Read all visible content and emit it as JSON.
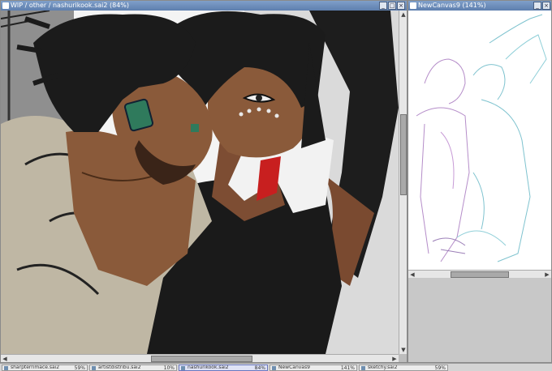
{
  "left_window": {
    "title": "WIP / other / nashurikook.sai2 (84%)",
    "buttons": [
      "_",
      "□",
      "×"
    ]
  },
  "right_window": {
    "title": "NewCanvas9 (141%)",
    "buttons": [
      "_",
      "×"
    ]
  },
  "colors": {
    "title_bar": "#6a8bbb",
    "skin": "#8a5a3a",
    "hair": "#1b1b1b",
    "hoodie": "#bfb7a4",
    "earring": "#2f7a5c",
    "accent_red": "#c81f1f",
    "sketch_purple": "#b58dc9",
    "sketch_cyan": "#7fc3cf"
  },
  "taskbar": {
    "tabs": [
      {
        "label": "sharpterrimace.sai2",
        "zoom": "59%"
      },
      {
        "label": "artistdistribu.sai2",
        "zoom": "10%"
      },
      {
        "label": "nashurikook.sai2",
        "zoom": "84%",
        "active": true
      },
      {
        "label": "NewCanvas9",
        "zoom": "141%"
      },
      {
        "label": "sketchy.sai2",
        "zoom": "59%"
      }
    ]
  }
}
